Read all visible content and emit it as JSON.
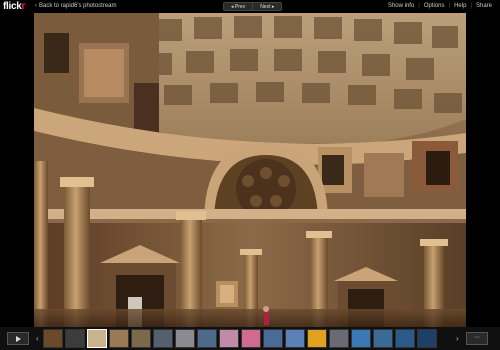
{
  "logo": {
    "text": "flickr",
    "accent": "#ff0084"
  },
  "nav": {
    "back_label": "Back to rapid6's photostream",
    "prev_label": "Prev",
    "next_label": "Next"
  },
  "menu": {
    "show_info": "Show info",
    "options": "Options",
    "help": "Help",
    "share": "Share"
  },
  "photo": {
    "subject": "Pantheon interior, Rome",
    "icon": "photo-image"
  },
  "filmstrip": {
    "play_icon": "play-icon",
    "left_arrow_icon": "chevron-left-icon",
    "right_arrow_icon": "chevron-right-icon",
    "expand_icon": "fullscreen-icon",
    "active_index": 2,
    "thumb_colors": [
      "#6b4a2a",
      "#3c3c3c",
      "#c9b48c",
      "#9a7a52",
      "#7a6a4a",
      "#55606e",
      "#8a8a90",
      "#4d6a8a",
      "#c08aa8",
      "#d06a90",
      "#4a6a9a",
      "#5a82b8",
      "#e0a020",
      "#6a6a74",
      "#3a78b8",
      "#3a6a98",
      "#2a5a8a",
      "#1f3f66"
    ]
  }
}
